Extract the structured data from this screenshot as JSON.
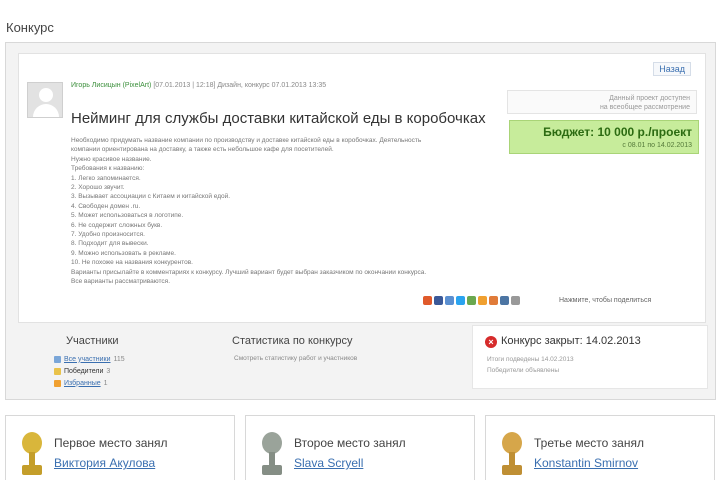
{
  "section_label": "Конкурс",
  "contest": {
    "back_link": "Назад",
    "meta": {
      "author": "Игорь Лисицын (PixelArt)",
      "details": "[07.01.2013 | 12:18] Дизайн, конкурс 07.01.2013 13:35"
    },
    "title": "Нейминг для службы доставки китайской еды в коробочках",
    "side_note": [
      "Данный проект доступен",
      "на всеобщее рассмотрение"
    ],
    "budget": {
      "amount": "Бюджет: 10 000 р./проект",
      "dates": "с 08.01 по 14.02.2013"
    },
    "description": [
      "Необходимо придумать название компании по производству и доставке китайской еды в коробочках. Деятельность",
      "компании ориентирована на доставку, а также есть небольшое кафе для посетителей.",
      "Нужно красивое название.",
      "Требования к названию:",
      "1. Легко запоминается.",
      "2. Хорошо звучит.",
      "3. Вызывает ассоциации с Китаем и китайской едой.",
      "4. Свободен домен .ru.",
      "5. Может использоваться в логотипе.",
      "6. Не содержит сложных букв.",
      "7. Удобно произносится.",
      "8. Подходит для вывески.",
      "9. Можно использовать в рекламе.",
      "10. Не похоже на названия конкурентов.",
      "Варианты присылайте в комментариях к конкурсу. Лучший вариант будет выбран заказчиком по окончании конкурса.",
      "Все варианты рассматриваются."
    ],
    "share_caption": "Нажмите, чтобы поделиться"
  },
  "participants": {
    "title": "Участники",
    "items": [
      {
        "label": "Все участники",
        "count": "115"
      },
      {
        "label": "Победители",
        "count": "3"
      },
      {
        "label": "Избранные",
        "count": "1"
      }
    ]
  },
  "stats": {
    "title": "Статистика по конкурсу",
    "subtitle": "Смотреть статистику работ и участников"
  },
  "closed": {
    "title": "Конкурс закрыт: 14.02.2013",
    "line1": "Итоги подведены 14.02.2013",
    "line2": "Победители объявлены"
  },
  "winners": [
    {
      "place": "Первое место занял",
      "name": "Виктория Акулова"
    },
    {
      "place": "Второе место занял",
      "name": "Slava Scryell"
    },
    {
      "place": "Третье место занял",
      "name": "Konstantin Smirnov"
    }
  ],
  "colors": {
    "link": "#3a6fb0",
    "budget_bg": "#c7ec9b",
    "budget_text": "#2c6b12",
    "closed_icon": "#d62b2b",
    "gold": "#d9b63b",
    "silver": "#9aa39a",
    "bronze": "#d6a64a"
  },
  "share_icons": [
    "#e05a2b",
    "#3b5998",
    "#5b8fd0",
    "#2aa3ef",
    "#6aa84f",
    "#f0a030",
    "#e07b39",
    "#4c75a3",
    "#999999"
  ],
  "icons": {
    "avatar": "user-silhouette-icon",
    "closed": "close-circle-icon",
    "trophy": "trophy-icon"
  }
}
